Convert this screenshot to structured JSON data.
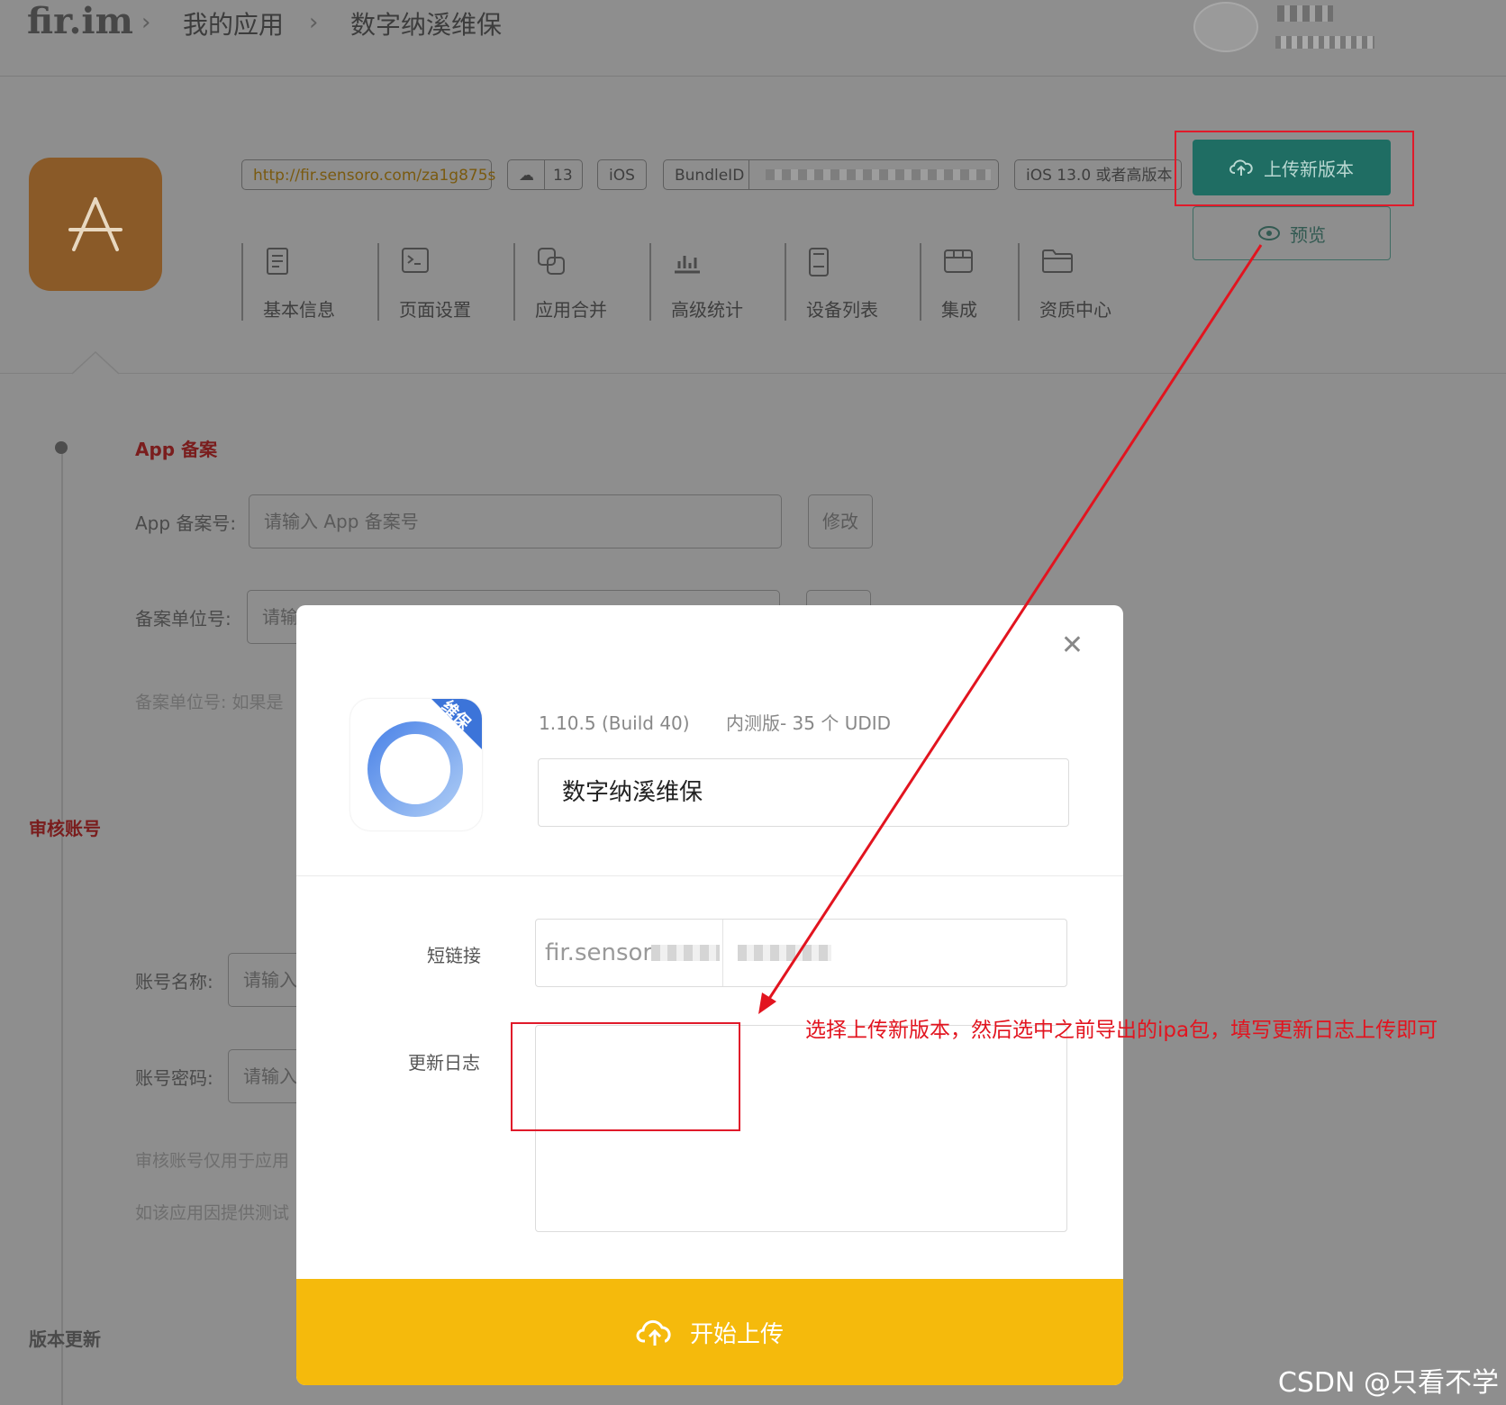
{
  "header": {
    "logo": "fir.im",
    "breadcrumb": [
      "我的应用",
      "数字纳溪维保"
    ]
  },
  "app": {
    "short_url": "http://fir.sensoro.com/za1g875s",
    "downloads": "13",
    "platform": "iOS",
    "bundle_label": "BundleID",
    "min_os": "iOS 13.0 或者高版本",
    "upload_label": "上传新版本",
    "preview_label": "预览"
  },
  "tabs": [
    {
      "label": "基本信息",
      "icon": "document-icon"
    },
    {
      "label": "页面设置",
      "icon": "terminal-icon"
    },
    {
      "label": "应用合并",
      "icon": "merge-icon"
    },
    {
      "label": "高级统计",
      "icon": "bar-chart-icon"
    },
    {
      "label": "设备列表",
      "icon": "phone-icon"
    },
    {
      "label": "集成",
      "icon": "box-icon"
    },
    {
      "label": "资质中心",
      "icon": "folder-icon"
    }
  ],
  "form": {
    "section_app_record": "App 备案",
    "record_no_label": "App 备案号:",
    "record_no_placeholder": "请输入 App 备案号",
    "modify_label": "修改",
    "unit_label": "备案单位号:",
    "unit_placeholder": "请输",
    "unit_hint": "备案单位号: 如果是",
    "section_review": "审核账号",
    "account_name_label": "账号名称:",
    "account_name_placeholder": "请输入",
    "account_pwd_label": "账号密码:",
    "account_pwd_placeholder": "请输入",
    "hint1": "审核账号仅用于应用",
    "hint2": "如该应用因提供测试",
    "section_update": "版本更新"
  },
  "modal": {
    "icon_badge": "维保",
    "version": "1.10.5 (Build 40)",
    "release_type": "内测版- 35 个 UDID",
    "app_name": "数字纳溪维保",
    "short_link_label": "短链接",
    "short_link_prefix": "fir.sensor",
    "changelog_label": "更新日志",
    "submit_label": "开始上传"
  },
  "annotation": "选择上传新版本，然后选中之前导出的ipa包，填写更新日志上传即可",
  "watermark": "CSDN @只看不学",
  "colors": {
    "overlay_bg": "#8e8e8e",
    "upload_btn": "#1f6d63",
    "submit_btn": "#f5ba0c",
    "annotation_red": "#e2141f",
    "section_title": "#7a1d1d"
  }
}
